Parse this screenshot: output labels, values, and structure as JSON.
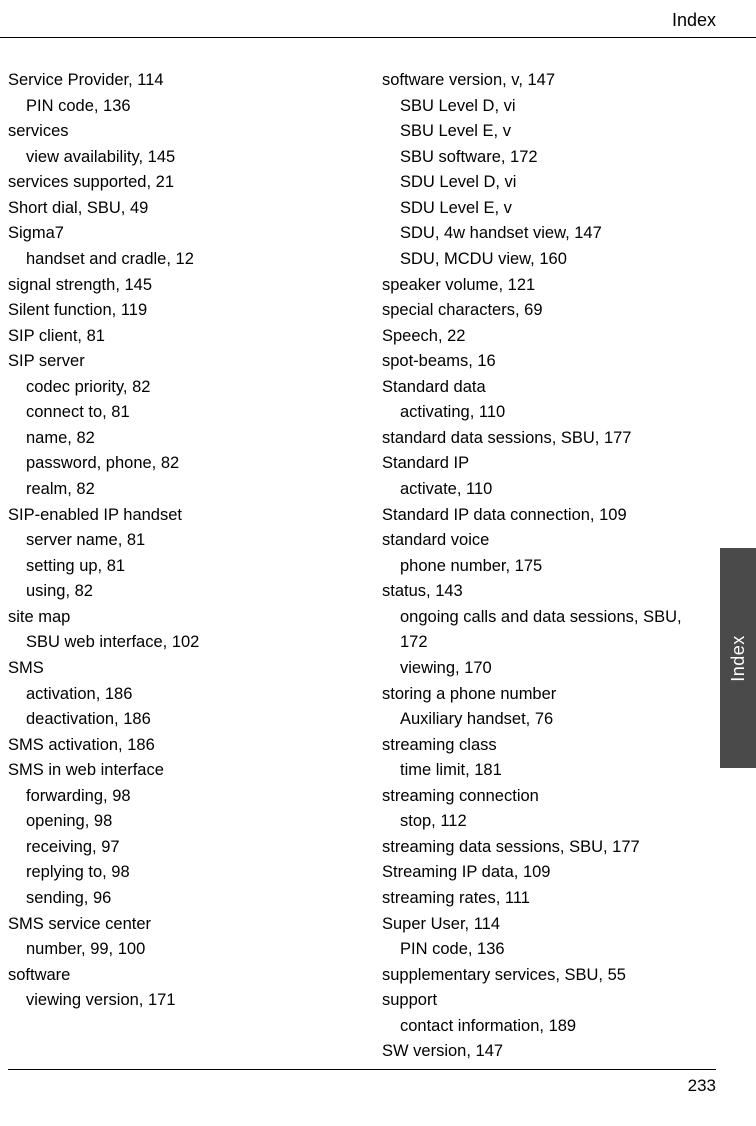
{
  "header": {
    "title": "Index"
  },
  "sideTab": {
    "label": "Index"
  },
  "footer": {
    "pageNumber": "233"
  },
  "columns": {
    "left": [
      {
        "text": "Service Provider, 114",
        "indent": 0
      },
      {
        "text": "PIN code, 136",
        "indent": 1
      },
      {
        "text": "services",
        "indent": 0
      },
      {
        "text": "view availability, 145",
        "indent": 1
      },
      {
        "text": "services supported, 21",
        "indent": 0
      },
      {
        "text": "Short dial, SBU, 49",
        "indent": 0
      },
      {
        "text": "Sigma7",
        "indent": 0
      },
      {
        "text": "handset and cradle, 12",
        "indent": 1
      },
      {
        "text": "signal strength, 145",
        "indent": 0
      },
      {
        "text": "Silent function, 119",
        "indent": 0
      },
      {
        "text": "SIP client, 81",
        "indent": 0
      },
      {
        "text": "SIP server",
        "indent": 0
      },
      {
        "text": "codec priority, 82",
        "indent": 1
      },
      {
        "text": "connect to, 81",
        "indent": 1
      },
      {
        "text": "name, 82",
        "indent": 1
      },
      {
        "text": "password, phone, 82",
        "indent": 1
      },
      {
        "text": "realm, 82",
        "indent": 1
      },
      {
        "text": "SIP-enabled IP handset",
        "indent": 0
      },
      {
        "text": "server name, 81",
        "indent": 1
      },
      {
        "text": "setting up, 81",
        "indent": 1
      },
      {
        "text": "using, 82",
        "indent": 1
      },
      {
        "text": "site map",
        "indent": 0
      },
      {
        "text": "SBU web interface, 102",
        "indent": 1
      },
      {
        "text": "SMS",
        "indent": 0
      },
      {
        "text": "activation, 186",
        "indent": 1
      },
      {
        "text": "deactivation, 186",
        "indent": 1
      },
      {
        "text": "SMS activation, 186",
        "indent": 0
      },
      {
        "text": "SMS in web interface",
        "indent": 0
      },
      {
        "text": "forwarding, 98",
        "indent": 1
      },
      {
        "text": "opening, 98",
        "indent": 1
      },
      {
        "text": "receiving, 97",
        "indent": 1
      },
      {
        "text": "replying to, 98",
        "indent": 1
      },
      {
        "text": "sending, 96",
        "indent": 1
      },
      {
        "text": "SMS service center",
        "indent": 0
      },
      {
        "text": "number, 99, 100",
        "indent": 1
      },
      {
        "text": "software",
        "indent": 0
      },
      {
        "text": "viewing version, 171",
        "indent": 1
      }
    ],
    "right": [
      {
        "text": "software version, v, 147",
        "indent": 0
      },
      {
        "text": "SBU Level D, vi",
        "indent": 1
      },
      {
        "text": "SBU Level E, v",
        "indent": 1
      },
      {
        "text": "SBU software, 172",
        "indent": 1
      },
      {
        "text": "SDU Level D, vi",
        "indent": 1
      },
      {
        "text": "SDU Level E, v",
        "indent": 1
      },
      {
        "text": "SDU, 4w handset view, 147",
        "indent": 1
      },
      {
        "text": "SDU, MCDU view, 160",
        "indent": 1
      },
      {
        "text": "speaker volume, 121",
        "indent": 0
      },
      {
        "text": "special characters, 69",
        "indent": 0
      },
      {
        "text": "Speech, 22",
        "indent": 0
      },
      {
        "text": "spot-beams, 16",
        "indent": 0
      },
      {
        "text": "Standard data",
        "indent": 0
      },
      {
        "text": "activating, 110",
        "indent": 1
      },
      {
        "text": "standard data sessions, SBU, 177",
        "indent": 0
      },
      {
        "text": "Standard IP",
        "indent": 0
      },
      {
        "text": "activate, 110",
        "indent": 1
      },
      {
        "text": "Standard IP data connection, 109",
        "indent": 0
      },
      {
        "text": "standard voice",
        "indent": 0
      },
      {
        "text": "phone number, 175",
        "indent": 1
      },
      {
        "text": "status, 143",
        "indent": 0
      },
      {
        "text": "ongoing calls and data sessions, SBU,",
        "indent": 1
      },
      {
        "text": "172",
        "indent": 1
      },
      {
        "text": "viewing, 170",
        "indent": 1
      },
      {
        "text": "storing a phone number",
        "indent": 0
      },
      {
        "text": "Auxiliary handset, 76",
        "indent": 1
      },
      {
        "text": "streaming class",
        "indent": 0
      },
      {
        "text": "time limit, 181",
        "indent": 1
      },
      {
        "text": "streaming connection",
        "indent": 0
      },
      {
        "text": "stop, 112",
        "indent": 1
      },
      {
        "text": "streaming data sessions, SBU, 177",
        "indent": 0
      },
      {
        "text": "Streaming IP data, 109",
        "indent": 0
      },
      {
        "text": "streaming rates, 111",
        "indent": 0
      },
      {
        "text": "Super User, 114",
        "indent": 0
      },
      {
        "text": "PIN code, 136",
        "indent": 1
      },
      {
        "text": "supplementary services, SBU, 55",
        "indent": 0
      },
      {
        "text": "support",
        "indent": 0
      },
      {
        "text": "contact information, 189",
        "indent": 1
      },
      {
        "text": "SW version, 147",
        "indent": 0
      }
    ]
  }
}
